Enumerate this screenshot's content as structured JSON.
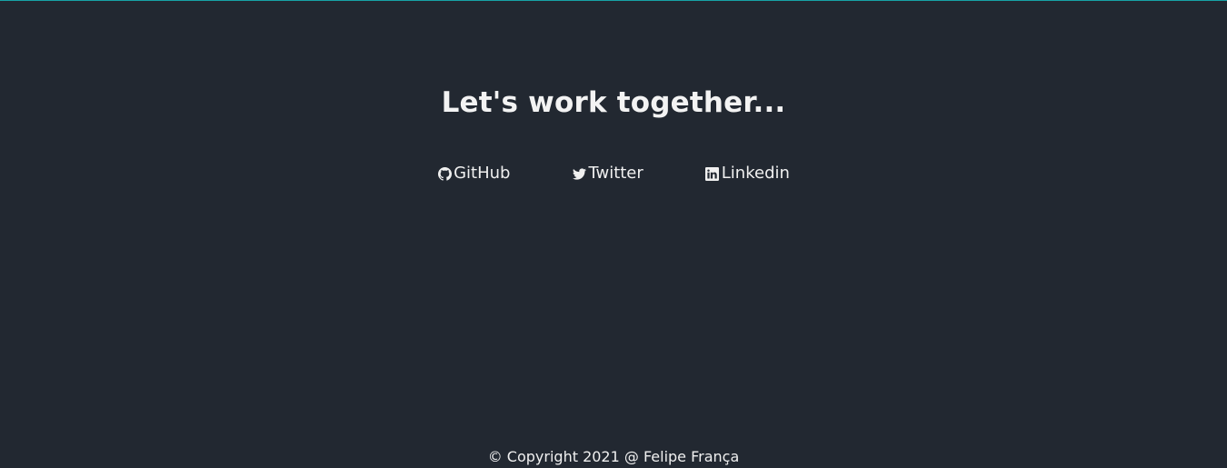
{
  "contact": {
    "headline": "Let's work together..."
  },
  "social": [
    {
      "label": "GitHub",
      "icon": "github-icon"
    },
    {
      "label": "Twitter",
      "icon": "twitter-icon"
    },
    {
      "label": "Linkedin",
      "icon": "linkedin-icon"
    }
  ],
  "footer": {
    "copyright": "© Copyright 2021 @ Felipe França"
  },
  "colors": {
    "background": "#222831",
    "accent_border": "#17a2a6",
    "text": "#f0f0f0"
  }
}
